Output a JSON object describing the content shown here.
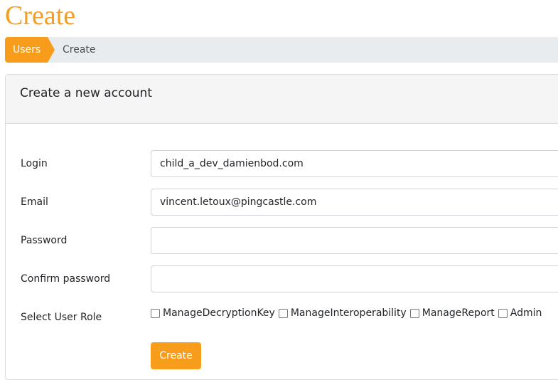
{
  "page": {
    "title": "Create"
  },
  "breadcrumb": {
    "items": [
      "Users",
      "Create"
    ]
  },
  "card": {
    "title": "Create a new account"
  },
  "form": {
    "login": {
      "label": "Login",
      "value": "child_a_dev_damienbod.com"
    },
    "email": {
      "label": "Email",
      "value": "vincent.letoux@pingcastle.com"
    },
    "password": {
      "label": "Password",
      "value": ""
    },
    "confirm": {
      "label": "Confirm password",
      "value": ""
    },
    "roles": {
      "label": "Select User Role",
      "options": [
        {
          "label": "ManageDecryptionKey",
          "checked": false
        },
        {
          "label": "ManageInteroperability",
          "checked": false
        },
        {
          "label": "ManageReport",
          "checked": false
        },
        {
          "label": "Admin",
          "checked": false
        }
      ]
    },
    "submit_label": "Create"
  },
  "colors": {
    "accent": "#f89c1c"
  }
}
